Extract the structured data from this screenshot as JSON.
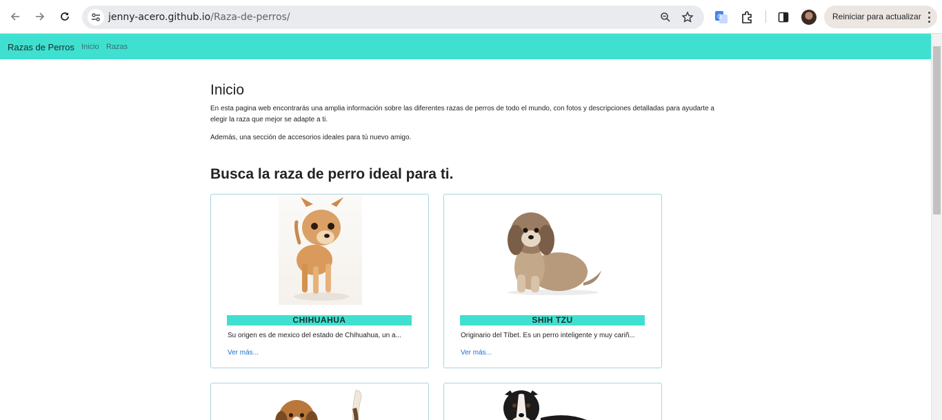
{
  "browser": {
    "url_domain": "jenny-acero.github.io",
    "url_path": "/Raza-de-perros/",
    "restart_label": "Reiniciar para actualizar",
    "icons": [
      "back-icon",
      "forward-icon",
      "reload-icon",
      "site-info-icon",
      "zoom-icon",
      "bookmark-star-icon",
      "translate-icon",
      "extensions-icon",
      "side-panel-icon",
      "profile-avatar",
      "menu-kebab-icon"
    ]
  },
  "navbar": {
    "brand": "Razas de Perros",
    "links": [
      "Inicio",
      "Razas"
    ],
    "bg_color": "#40e0d0"
  },
  "main": {
    "heading": "Inicio",
    "intro": "En esta pagina web encontrarás una amplia información sobre las diferentes razas de perros de todo el mundo, con fotos y descripciones detalladas para ayudarte a elegir la raza que mejor se adapte a ti.",
    "intro2": "Además, una sección de accesorios ideales para tú nuevo amigo.",
    "search_heading": "Busca la raza de perro ideal para ti."
  },
  "cards": [
    {
      "title": "CHIHUAHUA",
      "desc": "Su origen es de mexico del estado de Chihuahua, un a...",
      "more": "Ver más..."
    },
    {
      "title": "SHIH TZU",
      "desc": "Originario del Tíbet. Es un perro inteligente y muy cariñ...",
      "more": "Ver más..."
    }
  ]
}
